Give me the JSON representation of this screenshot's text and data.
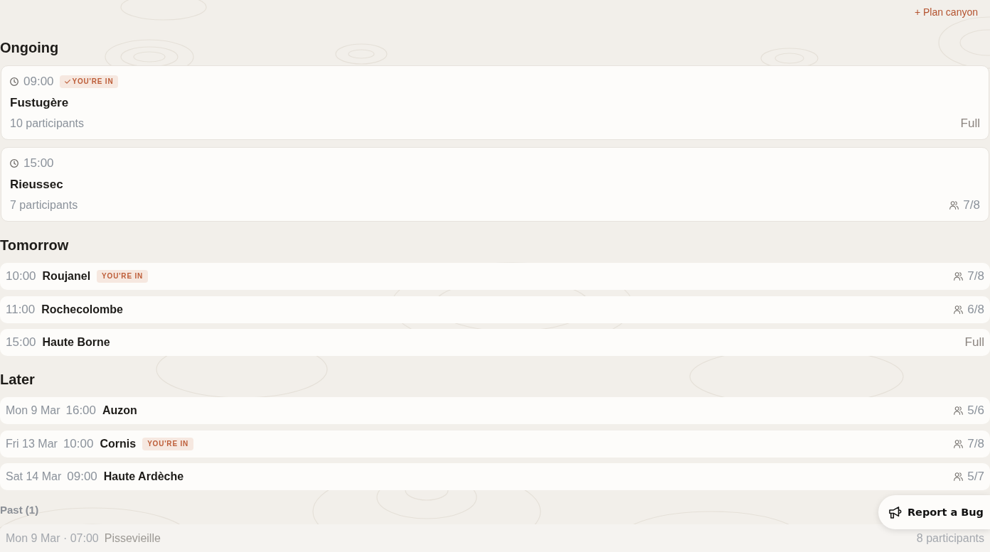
{
  "header": {
    "action_label": "+ Plan canyon"
  },
  "sections": [
    {
      "title": "Ongoing",
      "kind": "card",
      "items": [
        {
          "time": "09:00",
          "badge": "YOU'RE IN",
          "name": "Fustugère",
          "participants": "10 participants",
          "capacity": {
            "kind": "full",
            "text": "Full"
          }
        },
        {
          "time": "15:00",
          "name": "Rieussec",
          "participants": "7 participants",
          "capacity": {
            "kind": "spots",
            "text": "7/8"
          }
        }
      ]
    },
    {
      "title": "Tomorrow",
      "kind": "row",
      "items": [
        {
          "time": "10:00",
          "name": "Roujanel",
          "badge": "YOU'RE IN",
          "capacity": {
            "kind": "spots",
            "text": "7/8"
          }
        },
        {
          "time": "11:00",
          "name": "Rochecolombe",
          "capacity": {
            "kind": "spots",
            "text": "6/8"
          }
        },
        {
          "time": "15:00",
          "name": "Haute Borne",
          "capacity": {
            "kind": "full",
            "text": "Full"
          }
        }
      ]
    },
    {
      "title": "Later",
      "kind": "row",
      "items": [
        {
          "date": "Mon 9 Mar",
          "time": "16:00",
          "name": "Auzon",
          "capacity": {
            "kind": "spots",
            "text": "5/6"
          }
        },
        {
          "date": "Fri 13 Mar",
          "time": "10:00",
          "name": "Cornis",
          "badge": "YOU'RE IN",
          "capacity": {
            "kind": "spots",
            "text": "7/8"
          }
        },
        {
          "date": "Sat 14 Mar",
          "time": "09:00",
          "name": "Haute Ardèche",
          "capacity": {
            "kind": "spots",
            "text": "5/7"
          }
        }
      ]
    },
    {
      "title": "Past (1)",
      "kind": "past",
      "items": [
        {
          "when": "Mon 9 Mar · 07:00",
          "name": "Pissevieille",
          "participants": "8 participants"
        }
      ]
    }
  ],
  "report_button": {
    "label": "Report a Bug"
  }
}
